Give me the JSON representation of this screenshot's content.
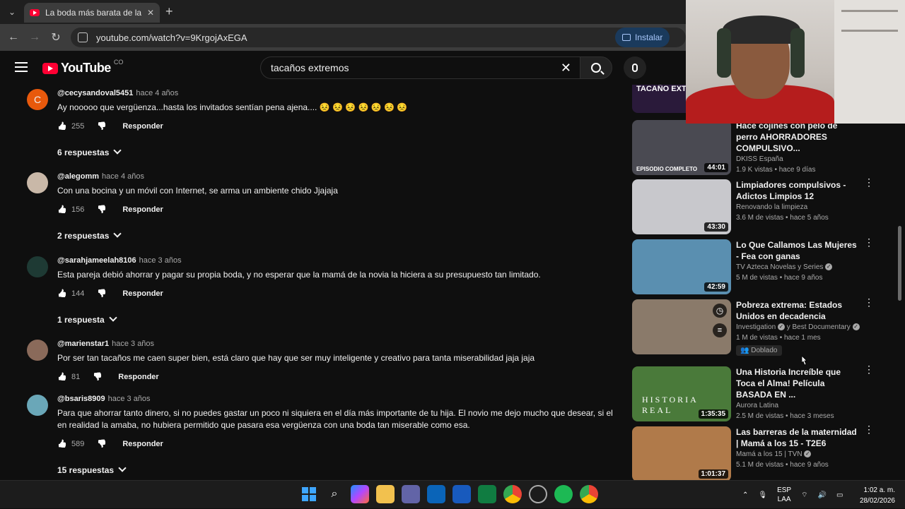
{
  "browser": {
    "tab_title": "La boda más barata de la histor",
    "url": "youtube.com/watch?v=9KrgojAxEGA",
    "install_label": "Instalar",
    "accent_color": "#a8c7fa"
  },
  "youtube": {
    "logo_text": "YouTube",
    "country_code": "CO",
    "search_query": "tacaños extremos"
  },
  "comments": [
    {
      "handle": "@cecysandoval5451",
      "time": "hace 4 años",
      "text": "Ay nooooo que vergüenza...hasta los invitados sentían pena ajena.... 😣 😣 😣 😣 😣 😣 😣",
      "likes": "255",
      "reply_label": "Responder",
      "replies": "6 respuestas",
      "avatar_color": "#e8590c",
      "avatar_letter": "C"
    },
    {
      "handle": "@alegomm",
      "time": "hace 4 años",
      "text": "Con una bocina y un móvil con Internet, se arma un ambiente chido Jjajaja",
      "likes": "156",
      "reply_label": "Responder",
      "replies": "2 respuestas",
      "avatar_color": "#c9b8a8"
    },
    {
      "handle": "@sarahjameelah8106",
      "time": "hace 3 años",
      "text": "Esta pareja debió ahorrar y pagar su propia boda, y no esperar que la mamá de la novia la hiciera a su presupuesto tan limitado.",
      "likes": "144",
      "reply_label": "Responder",
      "replies": "1 respuesta",
      "avatar_color": "#1e3a34"
    },
    {
      "handle": "@marienstar1",
      "time": "hace 3 años",
      "text": "Por ser tan tacaños me caen super bien, está claro que hay que ser muy inteligente y creativo para tanta miserabilidad jaja jaja",
      "likes": "81",
      "reply_label": "Responder",
      "avatar_color": "#8a6a5a"
    },
    {
      "handle": "@bsaris8909",
      "time": "hace 3 años",
      "text": "Para que ahorrar tanto dinero, si no puedes gastar un poco ni siquiera en el día más importante de tu hija. El novio me dejo mucho que desear, si el en realidad la amaba, no hubiera permitido que pasara esa vergüenza con una boda tan miserable como esa.",
      "likes": "589",
      "reply_label": "Responder",
      "replies": "15 respuestas",
      "avatar_color": "#6aa7b8"
    }
  ],
  "sidebar": {
    "top_partial_title": "TACAÑO EXTR",
    "videos": [
      {
        "title": "Hace cojines con pelo de perro AHORRADORES COMPULSIVO...",
        "channel": "DKISS España",
        "stats": "1.9 K vistas • hace 9 días",
        "duration": "44:01",
        "thumb_color": "#4a4a52",
        "thumb_text": "EPISODIO COMPLETO"
      },
      {
        "title": "Limpiadores compulsivos - Adictos Limpios 12",
        "channel": "Renovando la limpieza",
        "stats": "3.6 M de vistas • hace 5 años",
        "duration": "43:30",
        "thumb_color": "#c8c8cc"
      },
      {
        "title": "Lo Que Callamos Las Mujeres - Fea con ganas",
        "channel": "TV Azteca Novelas y Series",
        "stats": "5 M de vistas • hace 9 años",
        "duration": "42:59",
        "thumb_color": "#5a8fb0",
        "verified": true
      },
      {
        "title": "Pobreza extrema: Estados Unidos en decadencia",
        "channel": "Investigation",
        "channel2": "y Best Documentary",
        "stats": "1 M de vistas • hace 1 mes",
        "badge": "Doblado",
        "thumb_color": "#8a7a6a"
      },
      {
        "title": "Una Historia Increíble que Toca el Alma! Película BASADA EN ...",
        "channel": "Aurora Latina",
        "stats": "2.5 M de vistas • hace 3 meses",
        "duration": "1:35:35",
        "thumb_color": "#4a7a3a",
        "thumb_text": "HISTORIA REAL"
      },
      {
        "title": "Las barreras de la maternidad | Mamá a los 15 - T2E6",
        "channel": "Mamá a los 15 | TVN",
        "stats": "5.1 M de vistas • hace 9 años",
        "duration": "1:01:37",
        "thumb_color": "#b07a4a",
        "verified": true
      }
    ]
  },
  "taskbar": {
    "lang_line1": "ESP",
    "lang_line2": "LAA",
    "time": "1:02 a. m.",
    "date": "28/02/2026"
  }
}
